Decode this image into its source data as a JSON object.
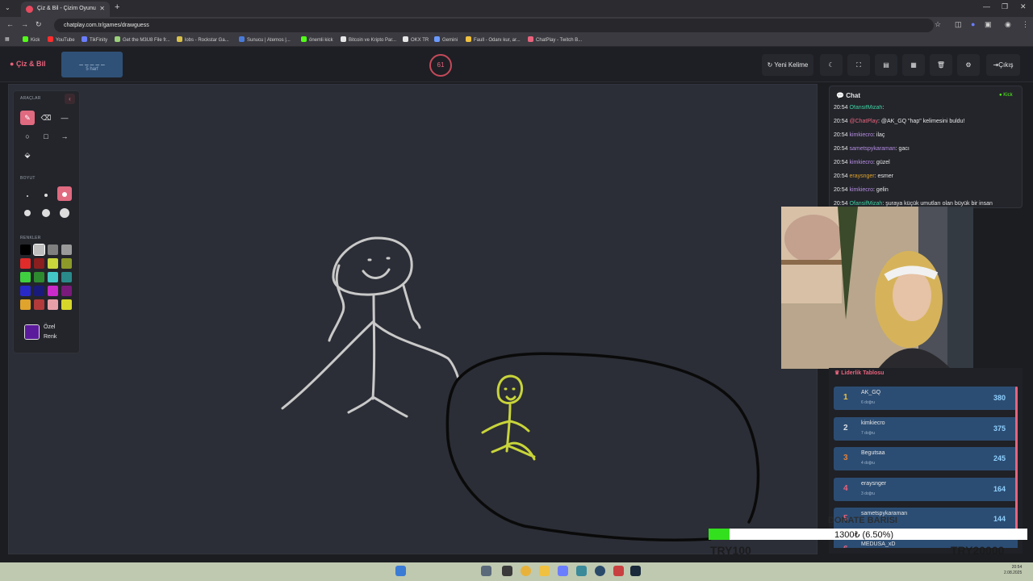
{
  "browser": {
    "tab_title": "Çiz & Bil - Çizim Oyunu",
    "url": "chatplay.com.tr/games/drawguess",
    "bookmarks": [
      "Kick",
      "YouTube",
      "TikFinity",
      "Get the M3U8 File fr...",
      "lobs - Rockstar Ga...",
      "Sunucu | Aternos |...",
      "önemli kick",
      "Bitcoin ve Kripto Par...",
      "OKX TR",
      "Gemini",
      "Faull - Odanı kur, ar...",
      "ChatPlay - Twitch B..."
    ]
  },
  "header": {
    "logo": "Çiz & Bil",
    "word_hint": "_ _ _ _ _",
    "word_letters": "5 harf",
    "timer": "61",
    "new_word": "Yeni Kelime",
    "logout": "Çıkış",
    "icons": [
      "moon-icon",
      "fullscreen-icon",
      "layout-icon",
      "panel-icon",
      "trash-icon",
      "gear-icon"
    ]
  },
  "tools": {
    "section_tools": "ARAÇLAR",
    "section_size": "BOYUT",
    "section_colors": "RENKLER",
    "custom_color_line1": "Özel",
    "custom_color_line2": "Renk",
    "custom_color": "#5b1a9b",
    "tool_icons": [
      "pencil-icon",
      "eraser-icon",
      "line-icon",
      "circle-icon",
      "square-icon",
      "arrow-icon",
      "fill-bucket-icon"
    ],
    "swatches": [
      "#000000",
      "#bfbfbf",
      "#7f7f7f",
      "#9a9a9a",
      "#e02b2b",
      "#8b1e1e",
      "#c9d63c",
      "#8c9a2a",
      "#3fd13f",
      "#2e8a2e",
      "#43c7c7",
      "#2a8a8a",
      "#2929c9",
      "#1a1a7a",
      "#c92ac9",
      "#7a1a7a",
      "#e0a32b",
      "#b33a3a",
      "#e8a0a8",
      "#d6d62a"
    ]
  },
  "chat": {
    "title": "Chat",
    "platform": "Kick",
    "messages": [
      {
        "time": "20:54",
        "user": "OfansifMizah",
        "text": "",
        "color": "#3fd1a0"
      },
      {
        "time": "20:54",
        "user": "@ChatPlay",
        "text": "@AK_GQ \"hap\" kelimesini buldu!",
        "color": "#e8637d"
      },
      {
        "time": "20:54",
        "user": "kimkiecro",
        "text": "ilaç",
        "color": "#b58be0"
      },
      {
        "time": "20:54",
        "user": "sametspykaraman",
        "text": "gacı",
        "color": "#b58be0"
      },
      {
        "time": "20:54",
        "user": "kimkiecro",
        "text": "güzel",
        "color": "#b58be0"
      },
      {
        "time": "20:54",
        "user": "eraysnger",
        "text": "esmer",
        "color": "#e0a32b"
      },
      {
        "time": "20:54",
        "user": "kimkiecro",
        "text": "gelin",
        "color": "#b58be0"
      },
      {
        "time": "20:54",
        "user": "OfansifMizah",
        "text": "şuraya küçük umutları olan büyük bir insan",
        "color": "#3fd1a0"
      }
    ]
  },
  "leaderboard": {
    "title": "Liderlik Tablosu",
    "rows": [
      {
        "rank": "1",
        "name": "AK_GQ",
        "sub": "6 doğru",
        "points": "380",
        "rank_color": "#f0c040"
      },
      {
        "rank": "2",
        "name": "kimkiecro",
        "sub": "7 doğru",
        "points": "375",
        "rank_color": "#d8dde6"
      },
      {
        "rank": "3",
        "name": "Begutsaa",
        "sub": "4 doğru",
        "points": "245",
        "rank_color": "#e0803a"
      },
      {
        "rank": "4",
        "name": "eraysnger",
        "sub": "3 doğru",
        "points": "164",
        "rank_color": "#e8637d"
      },
      {
        "rank": "5",
        "name": "sametspykaraman",
        "sub": "",
        "points": "144",
        "rank_color": "#e8637d"
      },
      {
        "rank": "6",
        "name": "MEDUSA_xD",
        "sub": "",
        "points": "",
        "rank_color": "#e8637d"
      }
    ]
  },
  "donate": {
    "title": "DONATE BARISI",
    "amount": "1300₺ (6.50%)",
    "progress": 0.065,
    "left_label": "TRY100",
    "right_label": "TRY20000"
  },
  "taskbar": {
    "time": "20:54",
    "date": "2.08.2025"
  }
}
